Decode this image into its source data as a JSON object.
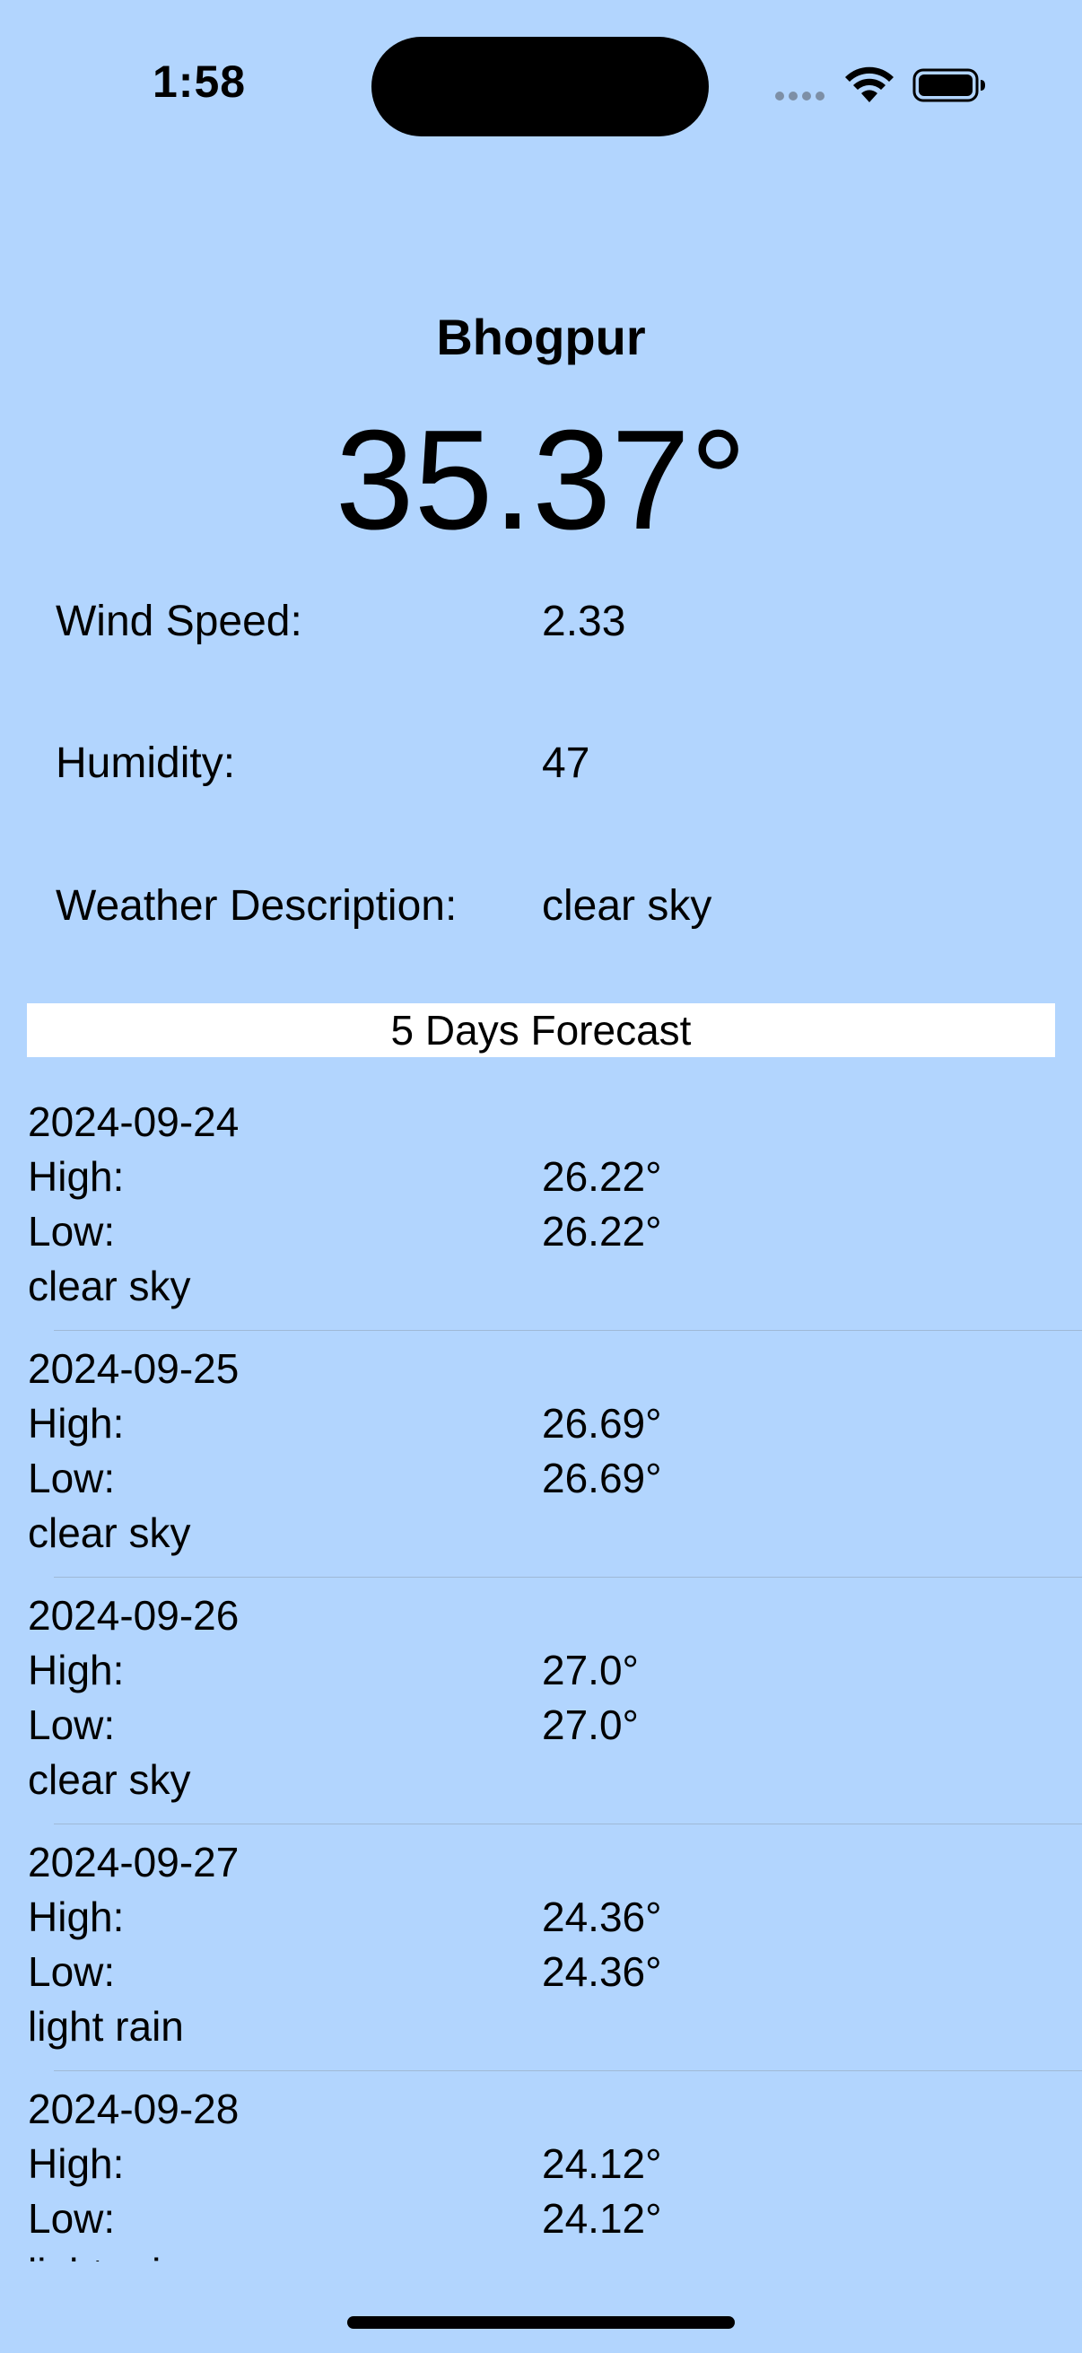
{
  "status_bar": {
    "time": "1:58"
  },
  "weather": {
    "city": "Bhogpur",
    "temperature": "35.37°",
    "details": [
      {
        "label": "Wind Speed:",
        "value": "2.33"
      },
      {
        "label": "Humidity:",
        "value": "47"
      },
      {
        "label": "Weather Description:",
        "value": "clear sky"
      }
    ]
  },
  "forecast": {
    "title": "5 Days Forecast",
    "high_label": "High:",
    "low_label": "Low:",
    "days": [
      {
        "date": "2024-09-24",
        "high": "26.22°",
        "low": "26.22°",
        "description": "clear sky"
      },
      {
        "date": "2024-09-25",
        "high": "26.69°",
        "low": "26.69°",
        "description": "clear sky"
      },
      {
        "date": "2024-09-26",
        "high": "27.0°",
        "low": "27.0°",
        "description": "clear sky"
      },
      {
        "date": "2024-09-27",
        "high": "24.36°",
        "low": "24.36°",
        "description": "light rain"
      },
      {
        "date": "2024-09-28",
        "high": "24.12°",
        "low": "24.12°",
        "description": "light rain"
      }
    ]
  },
  "colors": {
    "background": "#b2d5fe",
    "forecast_header_bg": "#ffffff",
    "text": "#000000"
  },
  "icons": {
    "signal": "signal-dots-icon",
    "wifi": "wifi-icon",
    "battery": "battery-icon"
  }
}
